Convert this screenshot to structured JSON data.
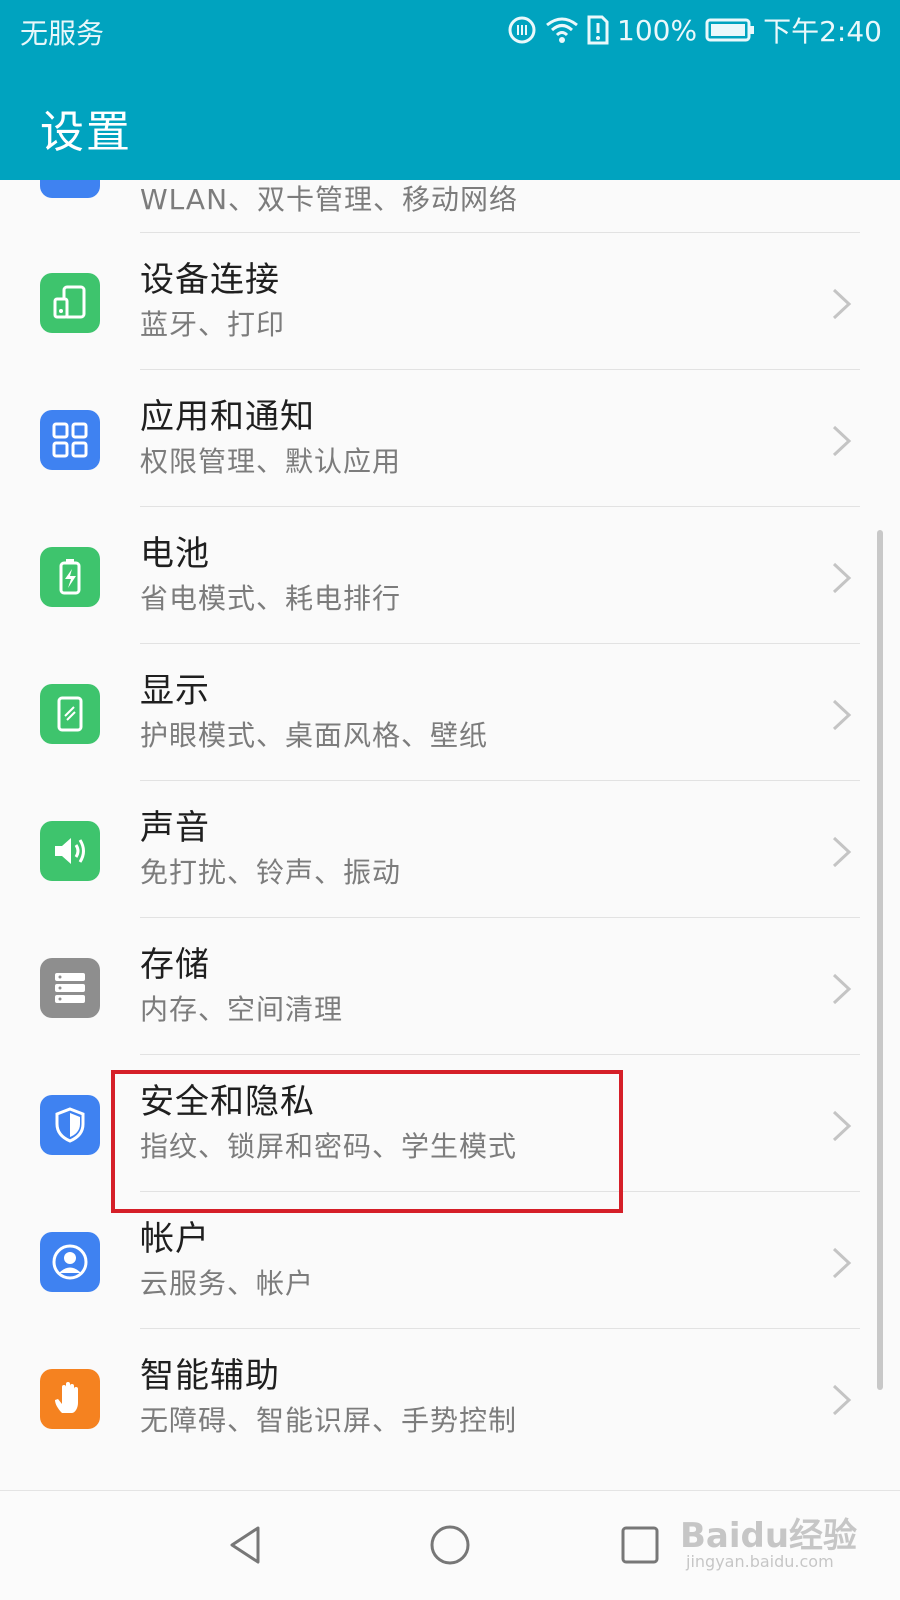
{
  "status_bar": {
    "carrier": "无服务",
    "battery": "100%",
    "time": "下午2:40"
  },
  "header": {
    "title": "设置"
  },
  "items": [
    {
      "title": "",
      "subtitle": "WLAN、双卡管理、移动网络",
      "icon": "network-icon",
      "color": "#3f82f1"
    },
    {
      "title": "设备连接",
      "subtitle": "蓝牙、打印",
      "icon": "device-connection-icon",
      "color": "#3ec46d"
    },
    {
      "title": "应用和通知",
      "subtitle": "权限管理、默认应用",
      "icon": "apps-grid-icon",
      "color": "#3f82f1"
    },
    {
      "title": "电池",
      "subtitle": "省电模式、耗电排行",
      "icon": "battery-icon",
      "color": "#3ec46d"
    },
    {
      "title": "显示",
      "subtitle": "护眼模式、桌面风格、壁纸",
      "icon": "display-icon",
      "color": "#3ec46d"
    },
    {
      "title": "声音",
      "subtitle": "免打扰、铃声、振动",
      "icon": "speaker-icon",
      "color": "#3ec46d"
    },
    {
      "title": "存储",
      "subtitle": "内存、空间清理",
      "icon": "storage-icon",
      "color": "#8e8e8e"
    },
    {
      "title": "安全和隐私",
      "subtitle": "指纹、锁屏和密码、学生模式",
      "icon": "shield-icon",
      "color": "#3f82f1"
    },
    {
      "title": "帐户",
      "subtitle": "云服务、帐户",
      "icon": "account-icon",
      "color": "#3f82f1"
    },
    {
      "title": "智能辅助",
      "subtitle": "无障碍、智能识屏、手势控制",
      "icon": "hand-icon",
      "color": "#f58220"
    }
  ],
  "watermark": {
    "main": "Baidu经验",
    "sub": "jingyan.baidu.com"
  }
}
